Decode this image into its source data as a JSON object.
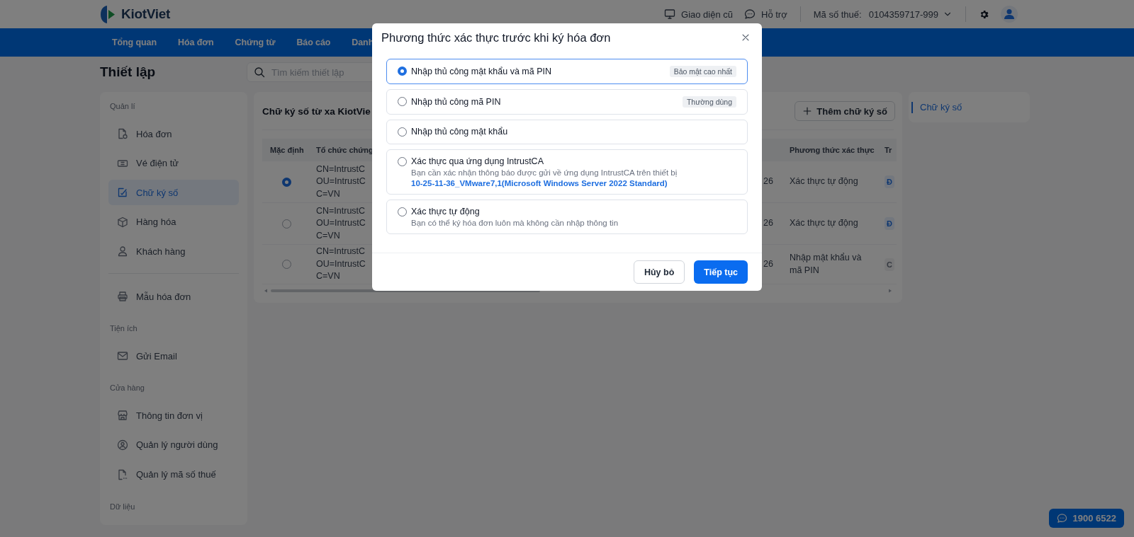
{
  "header": {
    "logo": "KiotViet",
    "links": [
      {
        "label": "Giao diện cũ"
      },
      {
        "label": "Hỗ trợ"
      }
    ],
    "tax_label": "Mã số thuế:",
    "tax_value": "0104359717-999"
  },
  "nav": {
    "items": [
      "Tổng quan",
      "Hóa đơn",
      "Chứng từ",
      "Báo cáo",
      "Danh"
    ]
  },
  "page_title": "Thiết lập",
  "search": {
    "placeholder": "Tìm kiếm thiết lập"
  },
  "sidebar": {
    "sections": [
      {
        "title": "Quản lí",
        "items": [
          {
            "label": "Hóa đơn",
            "selected": false
          },
          {
            "label": "Vé điện tử",
            "selected": false
          },
          {
            "label": "Chữ ký số",
            "selected": true
          },
          {
            "label": "Hàng hóa",
            "selected": false
          },
          {
            "label": "Khách hàng",
            "selected": false
          }
        ]
      },
      {
        "items": [
          {
            "label": "Mẫu hóa đơn",
            "selected": false
          }
        ]
      },
      {
        "title": "Tiện ích",
        "items": [
          {
            "label": "Gửi Email",
            "selected": false
          }
        ]
      },
      {
        "title": "Cửa hàng",
        "items": [
          {
            "label": "Thông tin đơn vị",
            "selected": false
          },
          {
            "label": "Quản lý người dùng",
            "selected": false
          },
          {
            "label": "Quản lý mã số thuế",
            "selected": false
          }
        ]
      },
      {
        "title": "Dữ liệu"
      }
    ]
  },
  "card": {
    "title": "Chữ ký số từ xa KiotVie",
    "add_button": "Thêm chữ ký số",
    "table": {
      "columns": {
        "default": "Mặc định",
        "issuer": "Tổ chức chứng",
        "method": "Phương thức xác thực",
        "status": "Tr"
      },
      "rows": [
        {
          "selected": true,
          "issuer": [
            "CN=IntrustC",
            "OU=IntrustC",
            "C=VN"
          ],
          "column_3": "26",
          "method": "Xác thực tự động",
          "status": {
            "text": "Đ",
            "kind": "active"
          }
        },
        {
          "selected": false,
          "issuer": [
            "CN=IntrustC",
            "OU=IntrustC",
            "C=VN"
          ],
          "column_3": "26",
          "method": "Xác thực tự động",
          "status": {
            "text": "Đ",
            "kind": "active"
          }
        },
        {
          "selected": false,
          "issuer": [
            "CN=IntrustC",
            "OU=IntrustC",
            "C=VN"
          ],
          "column_3": "26",
          "method": "Nhập mật khẩu và mã PIN",
          "status": {
            "text": "C",
            "kind": "inactive"
          }
        }
      ]
    }
  },
  "anchor": {
    "label": "Chữ ký số",
    "selected": true
  },
  "hotline": "1900 6522",
  "modal": {
    "title": "Phương thức xác thực trước khi ký hóa đơn",
    "options": [
      {
        "label": "Nhập thủ công mật khẩu và mã PIN",
        "tag": "Bảo mật cao nhất",
        "selected": true
      },
      {
        "label": "Nhập thủ công mã PIN",
        "tag": "Thường dùng",
        "selected": false
      },
      {
        "label": "Nhập thủ công mật khẩu",
        "selected": false
      },
      {
        "label": "Xác thực qua ứng dụng IntrustCA",
        "description": "Bạn cần xác nhận thông báo được gửi về ứng dụng IntrustCA trên thiết bị",
        "device": "10-25-11-36_VMware7,1(Microsoft Windows Server 2022 Standard)",
        "selected": false
      },
      {
        "label": "Xác thực tự động",
        "description": "Bạn có thể ký hóa đơn luôn mà không cần nhập thông tin",
        "selected": false
      }
    ],
    "cancel": "Hủy bỏ",
    "confirm": "Tiếp tục"
  }
}
